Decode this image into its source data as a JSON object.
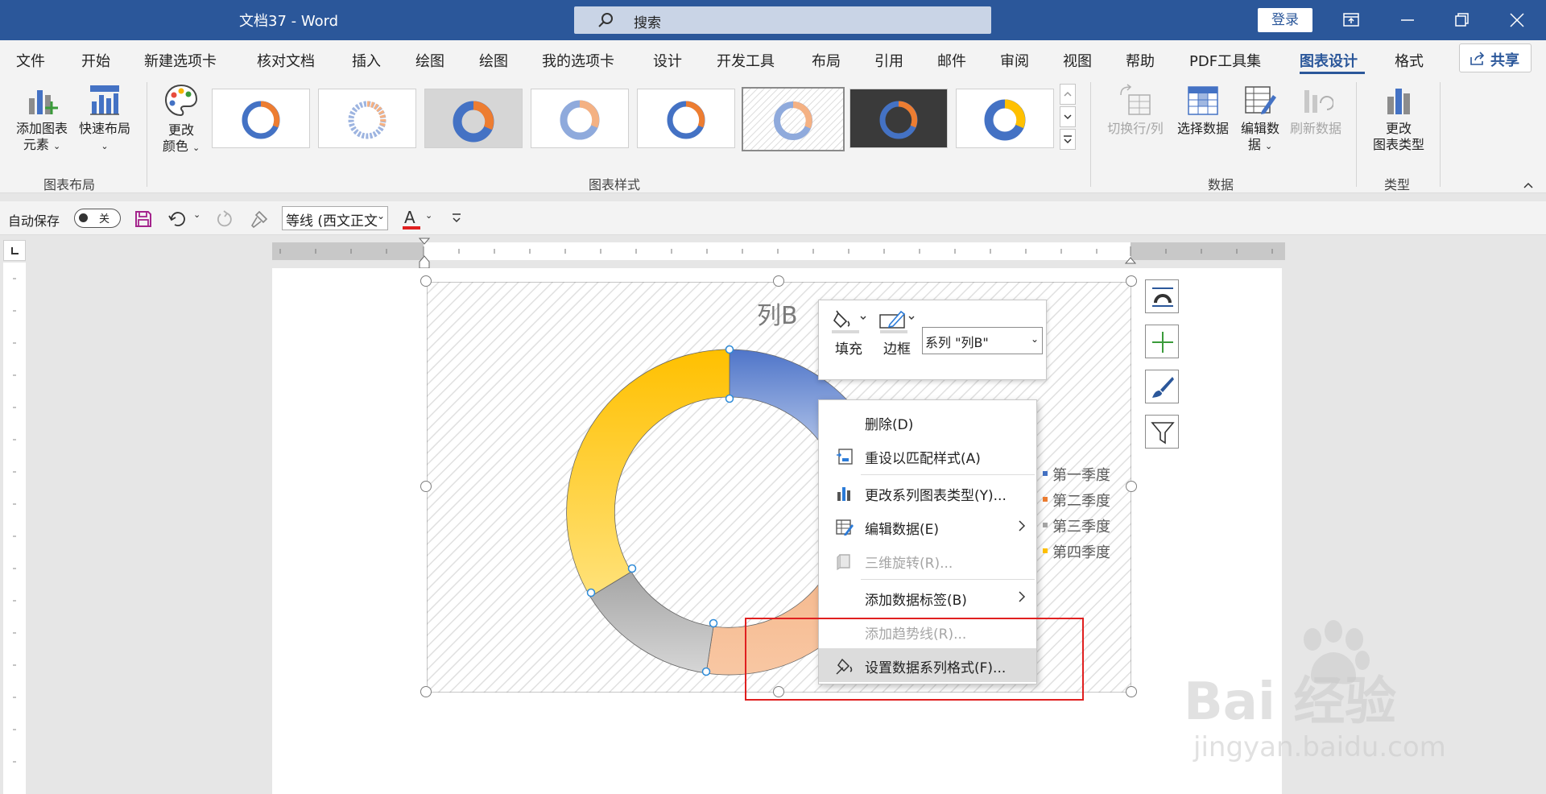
{
  "titlebar": {
    "doc_title": "文档37  -  Word",
    "search_placeholder": "搜索",
    "login_label": "登录"
  },
  "menu_tabs": [
    "文件",
    "开始",
    "新建选项卡",
    "核对文档",
    "插入",
    "绘图",
    "绘图",
    "我的选项卡",
    "设计",
    "开发工具",
    "布局",
    "引用",
    "邮件",
    "审阅",
    "视图",
    "帮助",
    "PDF工具集",
    "图表设计",
    "格式"
  ],
  "active_tab": "图表设计",
  "share_label": "共享",
  "ribbon": {
    "add_element": "添加图表元素",
    "add_element_l1": "添加图表",
    "add_element_l2": "元素",
    "quick_layout": "快速布局",
    "change_color_l1": "更改",
    "change_color_l2": "颜色",
    "group_layout": "图表布局",
    "group_styles": "图表样式",
    "switch_row_col": "切换行/列",
    "select_data": "选择数据",
    "edit_data_l1": "编辑数",
    "edit_data_l2": "据",
    "refresh_data": "刷新数据",
    "group_data": "数据",
    "change_type_l1": "更改",
    "change_type_l2": "图表类型",
    "group_type": "类型"
  },
  "qat": {
    "autosave_label": "自动保存",
    "toggle_state": "关",
    "font_name": "等线 (西文正文"
  },
  "chart": {
    "title": "列B",
    "legend": [
      {
        "name": "第一季度",
        "color": "#4472c4"
      },
      {
        "name": "第二季度",
        "color": "#ed7d31"
      },
      {
        "name": "第三季度",
        "color": "#a5a5a5"
      },
      {
        "name": "第四季度",
        "color": "#ffc000"
      }
    ]
  },
  "mini_toolbar": {
    "fill_label": "填充",
    "border_label": "边框",
    "series_value": "系列 \"列B\""
  },
  "context_menu": {
    "delete": "删除(D)",
    "reset_style": "重设以匹配样式(A)",
    "change_type": "更改系列图表类型(Y)...",
    "edit_data": "编辑数据(E)",
    "rotate_3d": "三维旋转(R)...",
    "add_labels": "添加数据标签(B)",
    "add_trendline": "添加趋势线(R)...",
    "format_series": "设置数据系列格式(F)..."
  },
  "watermark": {
    "main": "Bai 经验",
    "sub": "jingyan.baidu.com"
  },
  "colors": {
    "word_blue": "#2b579a",
    "highlight_red": "#e02020"
  }
}
